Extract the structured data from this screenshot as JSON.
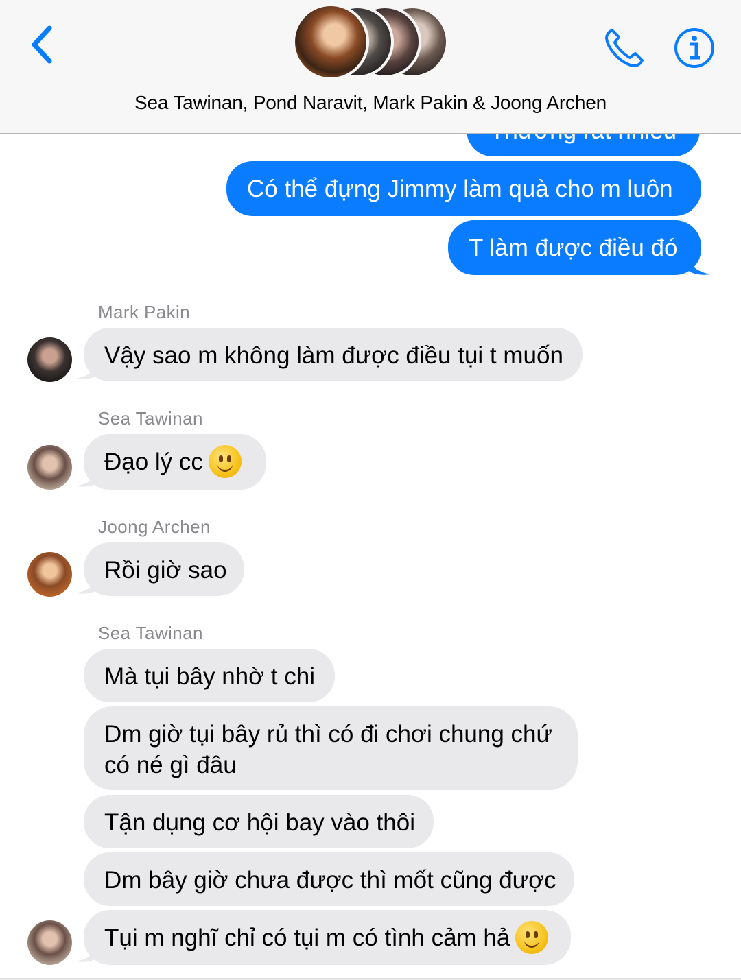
{
  "header": {
    "title": "Sea Tawinan, Pond Naravit, Mark Pakin & Joong Archen",
    "back_icon": "chevron-left-icon",
    "call_icon": "phone-icon",
    "info_icon": "info-icon",
    "accent_color": "#0a7cff"
  },
  "messages": {
    "out_cut": "Thương rất nhiều",
    "out_1": "Có thể đựng Jimmy làm quà cho m luôn",
    "out_2": "T làm được điều đó",
    "sender_mark": "Mark Pakin",
    "mark_1": "Vậy sao m không làm được điều tụi t muốn",
    "sender_sea_1": "Sea Tawinan",
    "sea_1": "Đạo lý cc",
    "sender_joong": "Joong Archen",
    "joong_1": "Rồi giờ sao",
    "sender_sea_2": "Sea Tawinan",
    "sea_2": "Mà tụi bây nhờ t chi",
    "sea_3": "Dm giờ tụi bây rủ thì có đi chơi chung chứ có né gì đâu",
    "sea_4": "Tận dụng cơ hội bay vào thôi",
    "sea_5": "Dm bây giờ chưa được thì mốt cũng được",
    "sea_6": "Tụi m nghĩ chỉ có tụi m có tình cảm hả"
  },
  "colors": {
    "outgoing_bubble": "#0a7cff",
    "incoming_bubble": "#e9e9eb",
    "sender_label": "#8a8a8e"
  }
}
